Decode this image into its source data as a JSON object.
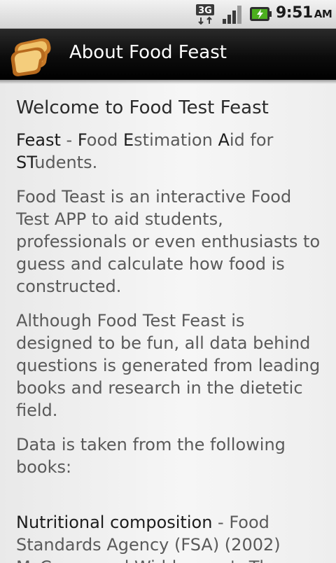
{
  "status_bar": {
    "network_label": "3G",
    "time": "9:51",
    "ampm": "AM",
    "icons": [
      "3g-data-icon",
      "signal-strength-icon",
      "battery-charging-icon"
    ]
  },
  "app_bar": {
    "icon": "toast-icon",
    "title": "About Food Feast"
  },
  "content": {
    "heading": "Welcome to Food Test Feast",
    "acronym": {
      "word": "Feast",
      "sep": " - ",
      "F": "F",
      "ood": "ood ",
      "E": "E",
      "stimation": "stimation ",
      "A": "A",
      "id_for": "id for ",
      "ST": "ST",
      "udents": "udents."
    },
    "para1": "Food Teast is an interactive Food Test APP to aid students, professionals or even enthusiasts to guess and calculate how food is constructed.",
    "para2": "Although Food Test Feast is designed to be fun, all data behind questions is generated from leading books and research in the dietetic field.",
    "para3": "Data is taken from the following books:",
    "book1": {
      "title": "Nutritional composition",
      "rest": " - Food Standards Agency (FSA) (2002)"
    },
    "book2_partial": "McCance and Widdowson's The"
  },
  "colors": {
    "title_bar": "#000000",
    "title_text": "#ffffff",
    "body_text": "#5a5a5a",
    "emphasis_text": "#1c1c1c",
    "battery_accent": "#4caf1e"
  }
}
